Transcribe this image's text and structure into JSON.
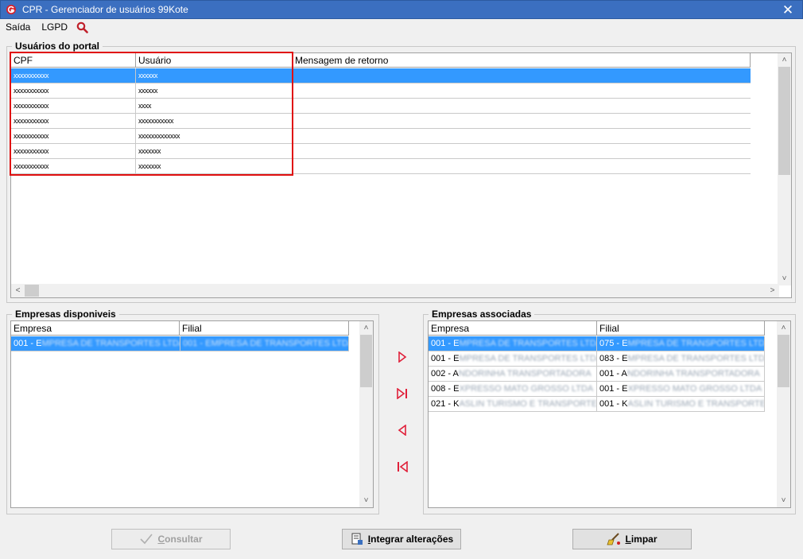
{
  "window": {
    "title": "CPR - Gerenciador de usuários 99Kote",
    "close_glyph": "✕"
  },
  "menu": {
    "items": [
      "Saída",
      "LGPD"
    ],
    "search_icon": "search-icon"
  },
  "users_group": {
    "title": "Usuários do portal",
    "columns": [
      "CPF",
      "Usuário",
      "Mensagem de retorno"
    ],
    "rows": [
      {
        "cpf": "xxxxxxxxxxx",
        "usuario": "xxxxxx",
        "mensagem": "",
        "selected": true
      },
      {
        "cpf": "xxxxxxxxxxx",
        "usuario": "xxxxxx",
        "mensagem": "",
        "selected": false
      },
      {
        "cpf": "xxxxxxxxxxx",
        "usuario": "xxxx",
        "mensagem": "",
        "selected": false
      },
      {
        "cpf": "xxxxxxxxxxx",
        "usuario": "xxxxxxxxxxx",
        "mensagem": "",
        "selected": false
      },
      {
        "cpf": "xxxxxxxxxxx",
        "usuario": "xxxxxxxxxxxxx",
        "mensagem": "",
        "selected": false
      },
      {
        "cpf": "xxxxxxxxxxx",
        "usuario": "xxxxxxx",
        "mensagem": "",
        "selected": false
      },
      {
        "cpf": "xxxxxxxxxxx",
        "usuario": "xxxxxxx",
        "mensagem": "",
        "selected": false
      }
    ]
  },
  "available_group": {
    "title": "Empresas disponiveis",
    "columns": [
      "Empresa",
      "Filial"
    ],
    "rows": [
      {
        "empresa_code": "001 - E",
        "empresa_rest": "MPRESA DE TRANSPORTES LTDA",
        "filial_code": "",
        "filial_rest": "001 - EMPRESA DE TRANSPORTES LTDA",
        "selected": true
      }
    ]
  },
  "associated_group": {
    "title": "Empresas associadas",
    "columns": [
      "Empresa",
      "Filial"
    ],
    "rows": [
      {
        "empresa_code": "001 - E",
        "empresa_rest": "MPRESA DE TRANSPORTES LTDA",
        "filial_code": "075 - E",
        "filial_rest": "MPRESA DE TRANSPORTES LTDA",
        "selected": true
      },
      {
        "empresa_code": "001 - E",
        "empresa_rest": "MPRESA DE TRANSPORTES LTDA",
        "filial_code": "083 - E",
        "filial_rest": "MPRESA DE TRANSPORTES LTDA",
        "selected": false
      },
      {
        "empresa_code": "002 - A",
        "empresa_rest": "NDORINHA TRANSPORTADORA",
        "filial_code": "001 - A",
        "filial_rest": "NDORINHA TRANSPORTADORA",
        "selected": false
      },
      {
        "empresa_code": "008 - E",
        "empresa_rest": "XPRESSO MATO GROSSO LTDA",
        "filial_code": "001 - E",
        "filial_rest": "XPRESSO MATO GROSSO LTDA",
        "selected": false
      },
      {
        "empresa_code": "021 - K",
        "empresa_rest": "ASLIN TURISMO E TRANSPORTES",
        "filial_code": "001 - K",
        "filial_rest": "ASLIN TURISMO E TRANSPORTES",
        "selected": false
      }
    ]
  },
  "move_buttons": [
    "move-right-icon",
    "move-all-right-icon",
    "move-left-icon",
    "move-all-left-icon"
  ],
  "buttons": {
    "consultar": {
      "mnemonic": "C",
      "rest": "onsultar",
      "enabled": false
    },
    "integrar": {
      "mnemonic": "I",
      "rest": "ntegrar alterações",
      "enabled": true
    },
    "limpar": {
      "mnemonic": "L",
      "rest": "impar",
      "enabled": true
    }
  },
  "colors": {
    "titlebar": "#3b6fc0",
    "selection": "#3399ff",
    "highlight_border": "#e01010",
    "arrow_icons": "#e0203a"
  }
}
